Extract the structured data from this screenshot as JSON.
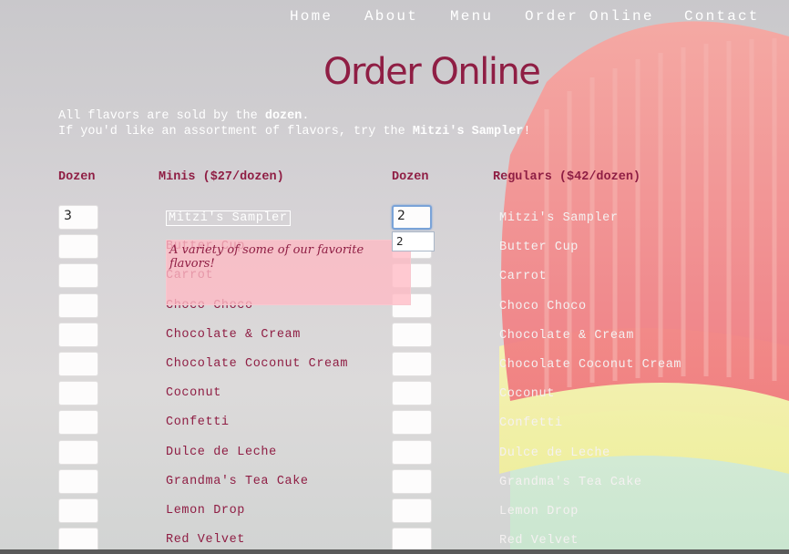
{
  "nav": {
    "items": [
      {
        "label": "Home"
      },
      {
        "label": "About"
      },
      {
        "label": "Menu"
      },
      {
        "label": "Order Online"
      },
      {
        "label": "Contact"
      }
    ]
  },
  "page": {
    "title": "Order Online",
    "intro": {
      "line1_prefix": "All flavors are sold by the ",
      "line1_bold": "dozen",
      "line1_suffix": ".",
      "line2_prefix": "If you'd like an assortment of flavors, try the ",
      "line2_bold": "Mitzi's Sampler",
      "line2_suffix": "!"
    }
  },
  "columns": {
    "minis_qty_header": "Dozen",
    "minis_header": "Minis ($27/dozen)",
    "regulars_qty_header": "Dozen",
    "regulars_header": "Regulars ($42/dozen)"
  },
  "flavors": [
    "Mitzi's Sampler",
    "Butter Cup",
    "Carrot",
    "Choco Choco",
    "Chocolate & Cream",
    "Chocolate Coconut Cream",
    "Coconut",
    "Confetti",
    "Dulce de Leche",
    "Grandma's Tea Cake",
    "Lemon Drop",
    "Red Velvet"
  ],
  "quantities": {
    "minis": [
      "3",
      "",
      "",
      "",
      "",
      "",
      "",
      "",
      "",
      "",
      "",
      ""
    ],
    "regulars": [
      "2",
      "",
      "",
      "",
      "",
      "",
      "",
      "",
      "",
      "",
      "",
      ""
    ]
  },
  "autocomplete": {
    "suggestion": "2"
  },
  "tooltip": {
    "text": "A variety of some of our favorite flavors!"
  },
  "colors": {
    "brand": "#8f1e44",
    "focus_ring": "#7aa3d8",
    "tooltip_bg": "#ffbac4"
  }
}
